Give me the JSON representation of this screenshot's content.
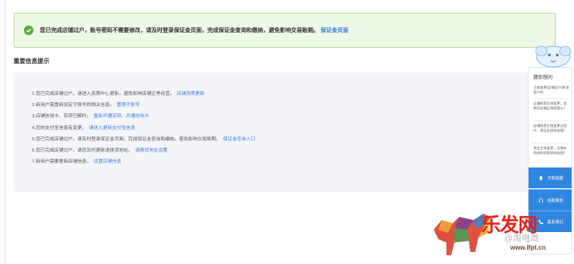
{
  "success_banner": {
    "message": "您已完成店铺过户，账号密码不需要修改，请及时登录保证金页面，完成保证金查询和缴纳，避免影响交易账期。",
    "link": "保证金页面"
  },
  "section_title": "重要信息提示",
  "notices": [
    {
      "text": "1.您已完成店铺过户，请进入资质中心更新，避免影响店铺正常经营。",
      "link": "店铺资质更新"
    },
    {
      "text": "2.新用户需重新设定子账号的相关信息。",
      "link": "管理子账号"
    },
    {
      "text": "3.店铺信用卡、花呗已解约。",
      "link": "重新开通花呗、开通信用卡"
    },
    {
      "text": "4.您的支付宝信息有变更。",
      "link": "请进入更新支付宝信息"
    },
    {
      "text": "5.您已完成店铺过户，请及时登录保证金页面，完成保证金查询和缴纳，避免影响交易账期。",
      "link": "保证金查询入口"
    },
    {
      "text": "6.您已完成店铺过户，请您及时更新退换货地址。",
      "link": "退换货地址设置"
    },
    {
      "text": "7.新用户需要更新店铺信息。",
      "link": "设置店铺信息"
    }
  ],
  "helper": {
    "title": "猜你想问",
    "questions": [
      "主体变更(店铺过户)新流程介绍",
      "店铺经营主体变更，变更后店铺正常经营么？",
      "店铺经营主体变更过程中，保证金如何处理？",
      "淘宝主体变更，店铺未完成的交易如何处理？"
    ],
    "buttons": [
      {
        "label": "万象提醒",
        "icon": "bell-icon"
      },
      {
        "label": "自助服务",
        "icon": "headset-icon"
      },
      {
        "label": "联系我们",
        "icon": "phone-icon"
      }
    ]
  },
  "watermark": {
    "brand": "乐发网",
    "site": "www.lfpt.cn",
    "cn_text": "@淘电商"
  },
  "colors": {
    "accent": "#3a7de0",
    "success_bg": "#eef8e6",
    "success_border": "#b9dd9a",
    "success_icon": "#59b03c",
    "panel_bg": "#f4f5f8",
    "helper_button": "#2e86e0",
    "watermark_red": "#e0231b"
  }
}
